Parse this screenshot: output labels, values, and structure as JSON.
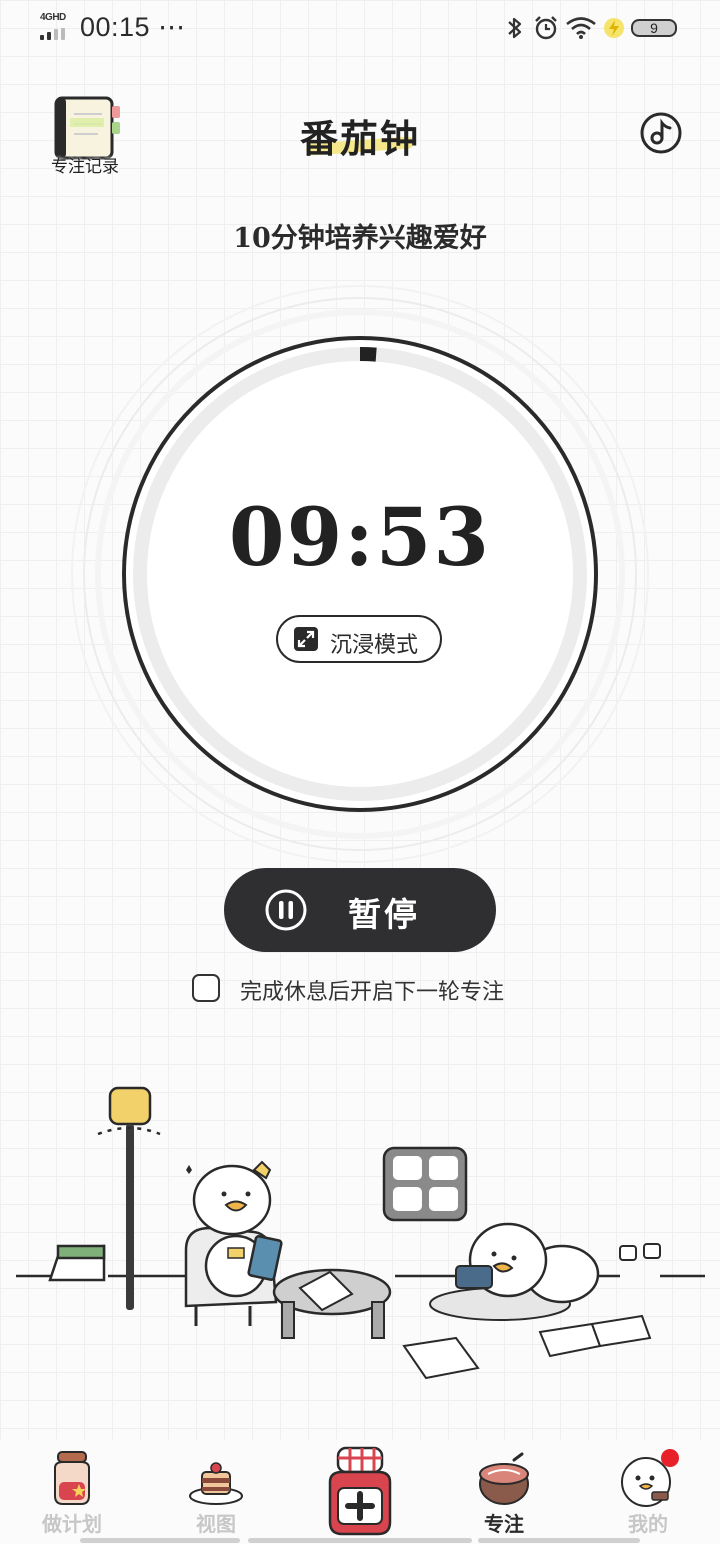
{
  "status_bar": {
    "network": "4GHD",
    "time": "00:15",
    "more": "⋯",
    "battery": "9"
  },
  "header": {
    "records_label": "专注记录",
    "title": "番茄钟",
    "music_icon": "music-note-icon"
  },
  "task": {
    "title": "10分钟培养兴趣爱好"
  },
  "timer": {
    "remaining": "09:53",
    "elapsed_fraction": 0.0117,
    "immersive_label": "沉浸模式"
  },
  "controls": {
    "pause_label": "暂停",
    "auto_next_label": "完成休息后开启下一轮专注",
    "auto_next_checked": false
  },
  "tabs": [
    {
      "label": "做计划",
      "icon": "jar-icon",
      "active": false
    },
    {
      "label": "视图",
      "icon": "cake-icon",
      "active": false
    },
    {
      "label": "",
      "icon": "add-jam-jar-icon",
      "active": false
    },
    {
      "label": "专注",
      "icon": "tomato-pot-icon",
      "active": true
    },
    {
      "label": "我的",
      "icon": "duck-avatar-icon",
      "active": false,
      "badge": true
    }
  ],
  "colors": {
    "accent_dark": "#2f2f32",
    "highlight": "#f6e78a",
    "badge": "#e8202a",
    "jar_red": "#d9454f"
  }
}
